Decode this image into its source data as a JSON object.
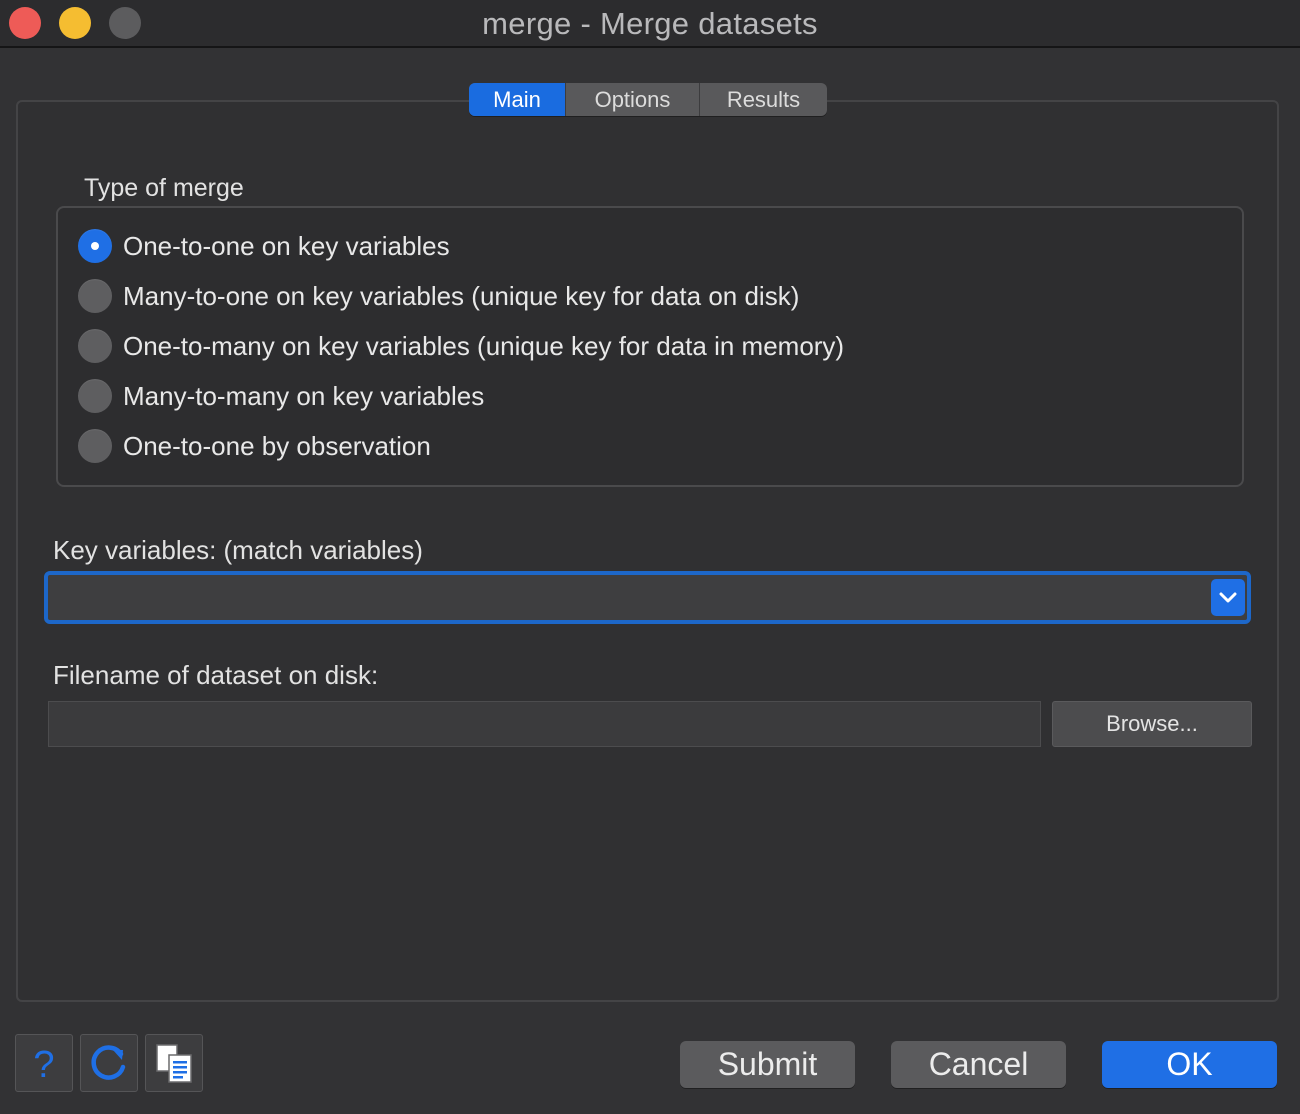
{
  "window": {
    "title": "merge - Merge datasets"
  },
  "tabs": [
    {
      "label": "Main",
      "active": true
    },
    {
      "label": "Options",
      "active": false
    },
    {
      "label": "Results",
      "active": false
    }
  ],
  "merge_type": {
    "label": "Type of merge",
    "options": [
      {
        "label": "One-to-one on key variables",
        "selected": true
      },
      {
        "label": "Many-to-one on key variables (unique key for data on disk)",
        "selected": false
      },
      {
        "label": "One-to-many on key variables (unique key for data in memory)",
        "selected": false
      },
      {
        "label": "Many-to-many on key variables",
        "selected": false
      },
      {
        "label": "One-to-one by observation",
        "selected": false
      }
    ]
  },
  "key_variables": {
    "label": "Key variables: (match variables)",
    "value": ""
  },
  "filename": {
    "label": "Filename of dataset on disk:",
    "value": "",
    "browse_label": "Browse..."
  },
  "footer": {
    "help_icon": "question-mark-icon",
    "reset_icon": "refresh-icon",
    "copy_icon": "copy-command-icon",
    "submit_label": "Submit",
    "cancel_label": "Cancel",
    "ok_label": "OK"
  },
  "colors": {
    "accent": "#1f6fe5",
    "background": "#323234"
  }
}
